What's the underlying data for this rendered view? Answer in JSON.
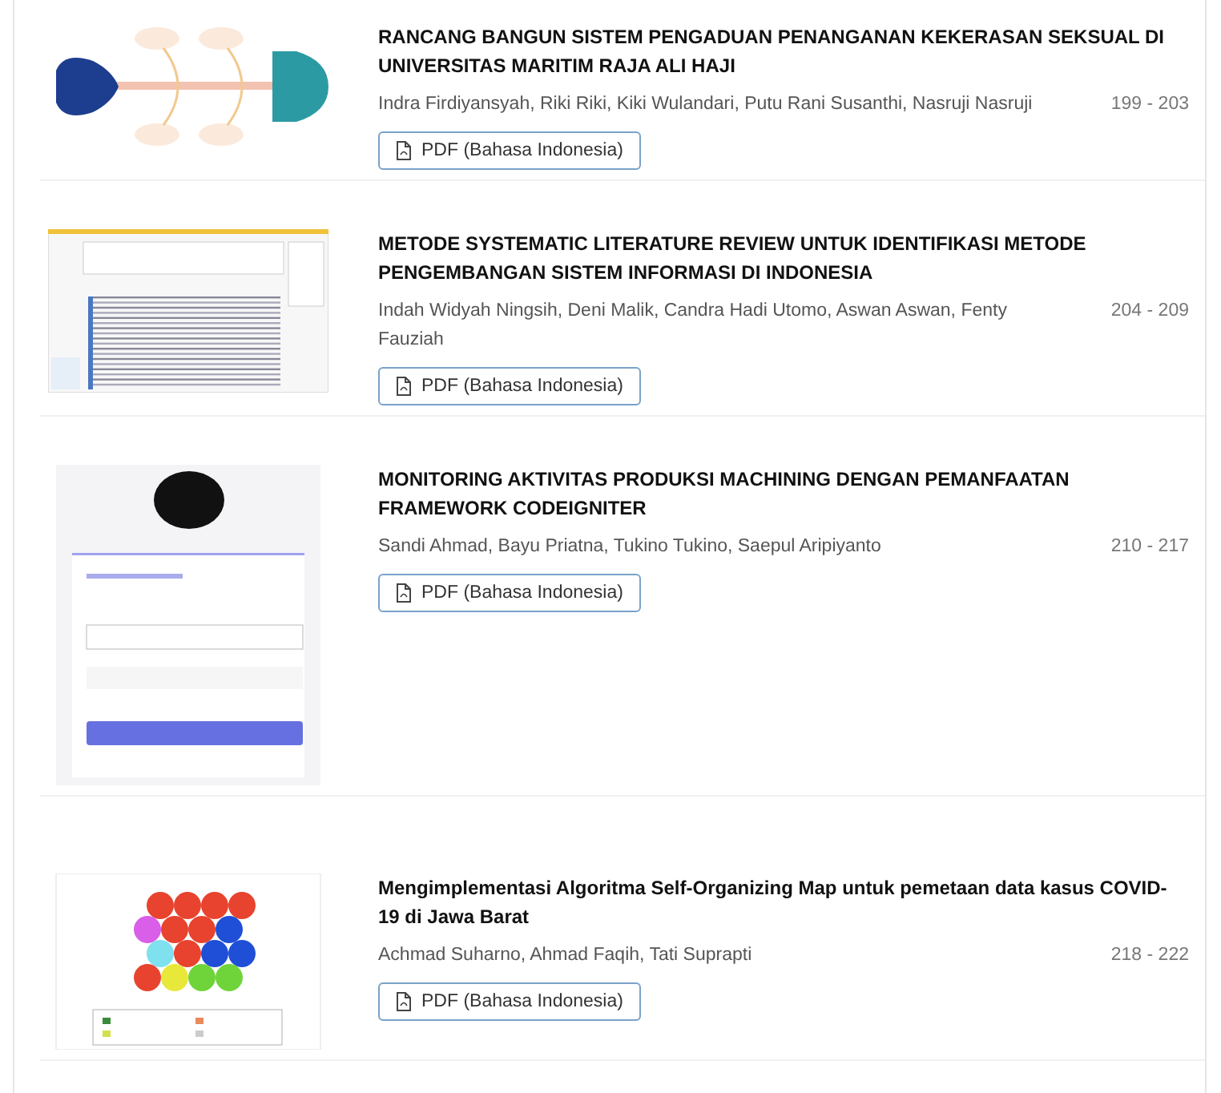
{
  "articles": [
    {
      "kind": "fishbone",
      "title": "RANCANG BANGUN SISTEM PENGADUAN PENANGANAN KEKERASAN SEKSUAL DI UNIVERSITAS MARITIM RAJA ALI HAJI",
      "authors": "Indra Firdiyansyah, Riki Riki, Kiki Wulandari, Putu Rani Susanthi, Nasruji Nasruji",
      "pages": "199 - 203",
      "galley": "PDF (Bahasa Indonesia)"
    },
    {
      "kind": "table-screenshot",
      "title": "METODE SYSTEMATIC LITERATURE REVIEW UNTUK IDENTIFIKASI METODE PENGEMBANGAN SISTEM INFORMASI DI INDONESIA",
      "authors": "Indah Widyah Ningsih, Deni Malik, Candra Hadi Utomo, Aswan Aswan, Fenty Fauziah",
      "pages": "204 - 209",
      "galley": "PDF (Bahasa Indonesia)"
    },
    {
      "kind": "login-form",
      "title": "MONITORING AKTIVITAS PRODUKSI MACHINING DENGAN PEMANFAATAN FRAMEWORK CODEIGNITER",
      "authors": "Sandi Ahmad, Bayu Priatna, Tukino Tukino, Saepul Aripiyanto",
      "pages": "210 - 217",
      "galley": "PDF (Bahasa Indonesia)"
    },
    {
      "kind": "hex-map",
      "title": "Mengimplementasi Algoritma Self-Organizing Map untuk pemetaan data kasus COVID-19 di Jawa Barat",
      "authors": "Achmad Suharno, Ahmad Faqih, Tati Suprapti",
      "pages": "218 - 222",
      "galley": "PDF (Bahasa Indonesia)"
    }
  ]
}
